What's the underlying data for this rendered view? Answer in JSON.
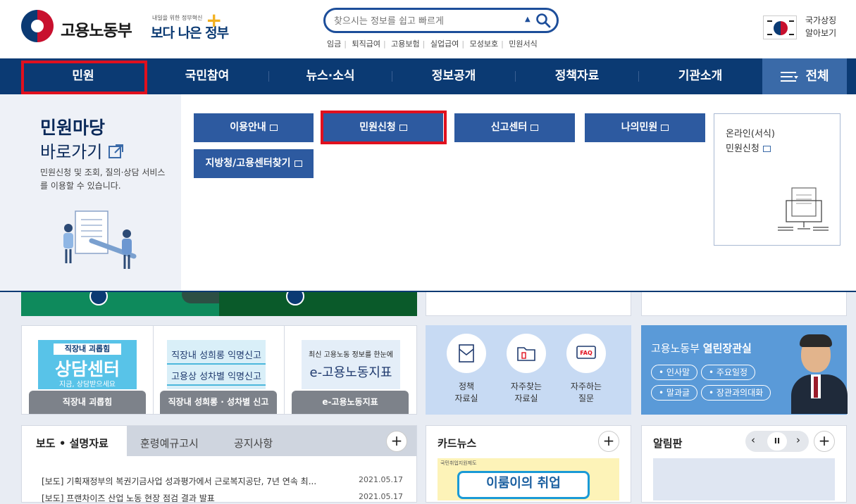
{
  "header": {
    "logo_text": "고용노동부",
    "slogan_small": "내일을 위한 정부혁신",
    "slogan_big": "보다 나은 정부",
    "search_placeholder": "찾으시는 정보를 쉽고 빠르게",
    "quick_links": [
      "임금",
      "퇴직급여",
      "고용보험",
      "실업급여",
      "모성보호",
      "민원서식"
    ],
    "national_symbol": [
      "국가상징",
      "알아보기"
    ]
  },
  "nav": {
    "items": [
      "민원",
      "국민참여",
      "뉴스·소식",
      "정보공개",
      "정책자료",
      "기관소개"
    ],
    "all_label": "전체"
  },
  "dropdown": {
    "title": "민원마당",
    "subtitle": "바로가기",
    "description": "민원신청 및 조회, 질의·상담 서비스를 이용할 수 있습니다.",
    "buttons": [
      "이용안내",
      "민원신청",
      "신고센터",
      "나의민원",
      "지방청/고용센터찾기"
    ],
    "card": [
      "온라인(서식)",
      "민원신청"
    ]
  },
  "banners": {
    "b1_top": "직장내 괴롭힘",
    "b1_main": "상담센터",
    "b1_sub": "지금, 상담받으세요",
    "b1_label": "직장내 괴롭힘",
    "b2_line1": "직장내 성희롱 익명신고",
    "b2_line2": "고용상 성차별 익명신고",
    "b2_label": "직장내 성희롱 · 성차별 신고",
    "b3_top": "최신 고용노동 정보를 한눈에",
    "b3_main": "e-고용노동지표",
    "b3_label": "e-고용노동지표"
  },
  "quick_icons": [
    {
      "line1": "정책",
      "line2": "자료실"
    },
    {
      "line1": "자주찾는",
      "line2": "자료실"
    },
    {
      "line1": "자주하는",
      "line2": "질문"
    }
  ],
  "minister": {
    "title_a": "고용노동부",
    "title_b": "열린장관실",
    "pills": [
      "인사말",
      "주요일정",
      "말과글",
      "장관과의대화"
    ]
  },
  "news": {
    "tabs": [
      "보도 • 설명자료",
      "훈령예규고시",
      "공지사항"
    ],
    "items": [
      {
        "text": "[보도] 기획재정부의 복권기금사업 성과평가에서 근로복지공단, 7년 연속 최...",
        "date": "2021.05.17"
      },
      {
        "text": "[보도] 프랜차이즈 산업 노동 현장 점검 결과 발표",
        "date": "2021.05.17"
      }
    ]
  },
  "cardnews": {
    "title": "카드뉴스",
    "img_top": "국민취업지원제도",
    "img_main": "이룸이의 취업"
  },
  "notice": {
    "title": "알림판",
    "pause": "II"
  },
  "colors": {
    "navy": "#0b3a73",
    "button": "#2d5aa0",
    "red_highlight": "#e0101e",
    "green_band": "#0e8a5c"
  }
}
